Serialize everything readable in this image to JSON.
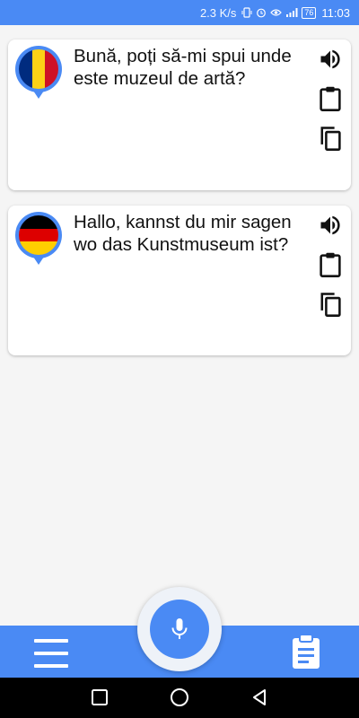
{
  "status_bar": {
    "network_speed": "2.3 K/s",
    "battery": "76",
    "time": "11:03",
    "icons": [
      "vibrate-icon",
      "alarm-icon",
      "eye-icon",
      "signal-icon",
      "battery-icon"
    ]
  },
  "cards": [
    {
      "language_flag": "romania-flag",
      "text": "Bună, poți să-mi spui unde este muzeul de artă?",
      "actions": [
        "speaker-icon",
        "clipboard-icon",
        "copy-icon"
      ]
    },
    {
      "language_flag": "germany-flag",
      "text": "Hallo, kannst du mir sagen wo das Kunstmuseum ist?",
      "actions": [
        "speaker-icon",
        "clipboard-icon",
        "copy-icon"
      ]
    }
  ],
  "bottom_bar": {
    "left_icon": "menu-icon",
    "center_icon": "microphone-icon",
    "right_icon": "history-icon"
  },
  "nav_bar": {
    "icons": [
      "recents-icon",
      "home-icon",
      "back-icon"
    ]
  },
  "colors": {
    "accent": "#4a8af4",
    "card_bg": "#ffffff",
    "page_bg": "#f5f5f5"
  }
}
